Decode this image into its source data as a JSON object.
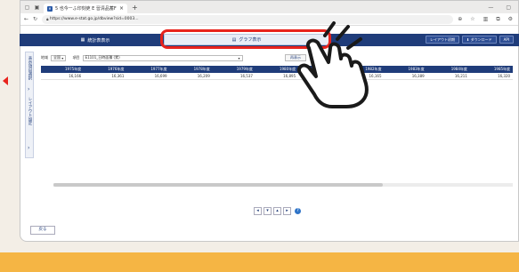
{
  "browser": {
    "tab_title": "5 也今ーふ印刻吏 E 晉清品蓄F",
    "new_tab": "+",
    "url": "https://www.e-stat.go.jp/dbview?sid=0003..."
  },
  "toolbar": {
    "stat_table_label": "統計表表示",
    "graph_label": "グラフ表示",
    "layout_reset_label": "レイアウト初期",
    "download_label": "ダウンロード",
    "api_label": "API"
  },
  "sidebar": {
    "item1": "表示項目選択",
    "item2": "レイアウト設定"
  },
  "filters": {
    "label1": "地域",
    "value1": "全国",
    "label2": "項目",
    "value2": "E1101_日時面積 (累)",
    "display_button": "再表示"
  },
  "table": {
    "headers": [
      "1975年度",
      "1976年度",
      "1977年度",
      "1978年度",
      "1979年度",
      "1980年度",
      "1981年度",
      "1982年度",
      "1983年度",
      "1984年度",
      "1985年度"
    ],
    "row": [
      "16,166",
      "16,361",
      "16,699",
      "16,209",
      "16,537",
      "16,895",
      "—",
      "16,165",
      "16,389",
      "16,211",
      "16,320"
    ]
  },
  "back_button": "戻る",
  "colors": {
    "navy": "#1f3c7a",
    "highlight": "#e8231d",
    "band": "#f5b544"
  }
}
